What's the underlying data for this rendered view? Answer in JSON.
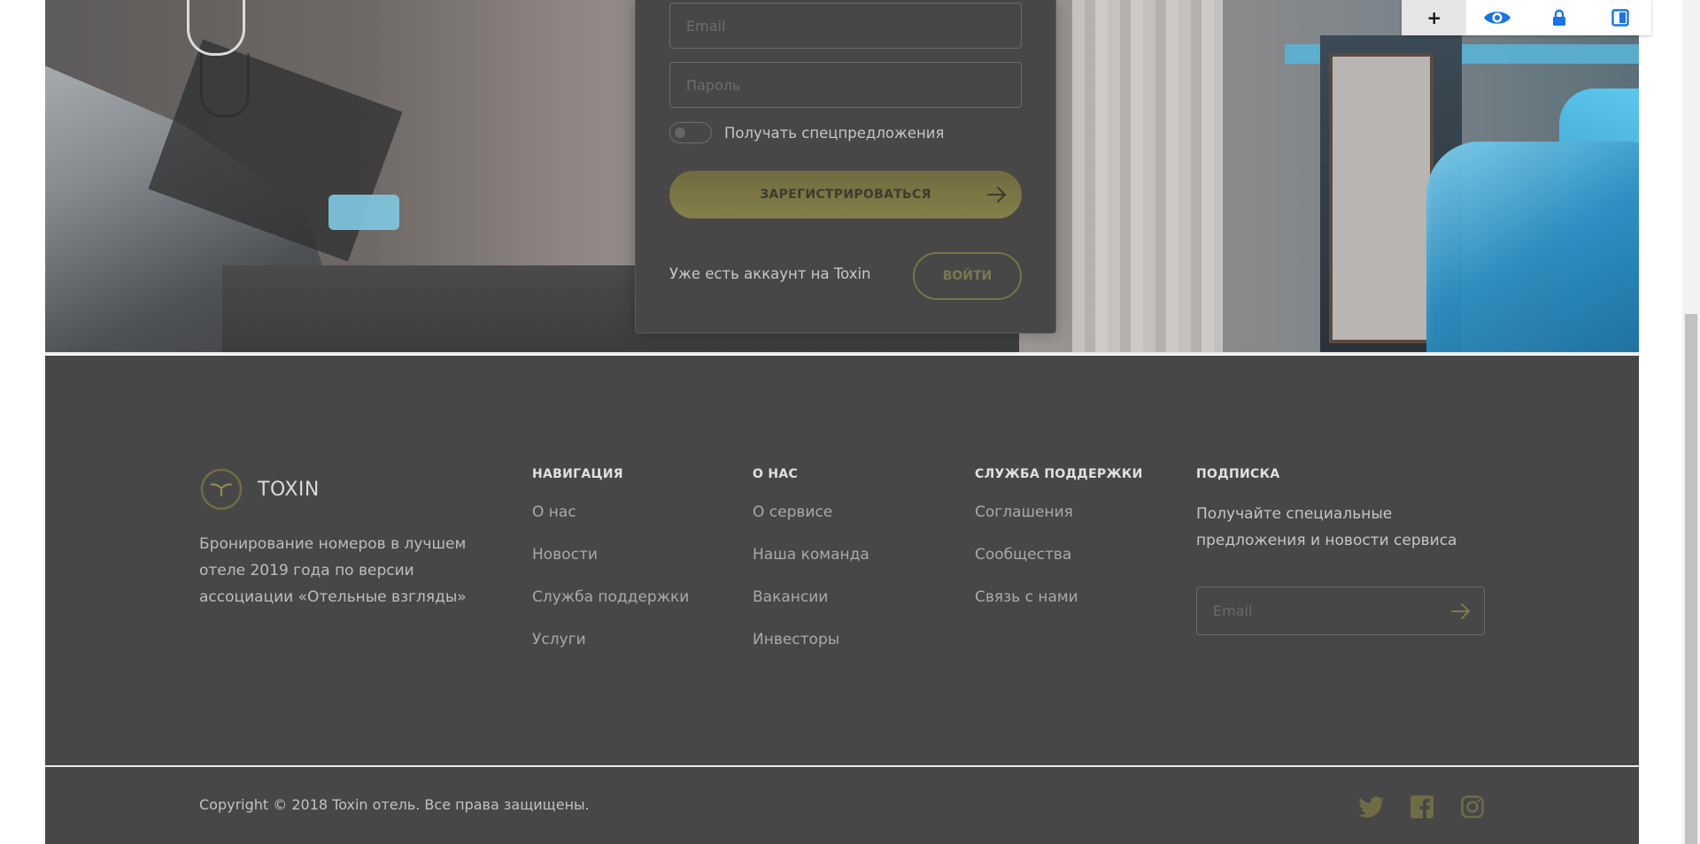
{
  "registration": {
    "email_placeholder": "Email",
    "password_placeholder": "Пароль",
    "special_offers_label": "Получать спецпредложения",
    "special_offers_on": false,
    "register_button": "ЗАРЕГИСТРИРОВАТЬСЯ",
    "have_account_text": "Уже есть аккаунт на Toxin",
    "login_button": "ВОЙТИ"
  },
  "extension_toolbar": {
    "icons": [
      "plus-icon",
      "eye-icon",
      "lock-icon",
      "sidebar-icon"
    ],
    "plus_label": "+"
  },
  "footer": {
    "brand": "TOXIN",
    "about": "Бронирование номеров в лучшем отеле 2019 года по версии ассоциации «Отельные взгляды»",
    "columns": [
      {
        "title": "НАВИГАЦИЯ",
        "links": [
          "О нас",
          "Новости",
          "Служба поддержки",
          "Услуги"
        ]
      },
      {
        "title": "О НАС",
        "links": [
          "О сервисе",
          "Наша команда",
          "Вакансии",
          "Инвесторы"
        ]
      },
      {
        "title": "СЛУЖБА ПОДДЕРЖКИ",
        "links": [
          "Соглашения",
          "Сообщества",
          "Связь с нами"
        ]
      }
    ],
    "subscribe": {
      "title": "ПОДПИСКА",
      "text": "Получайте специальные предложения и новости сервиса",
      "email_placeholder": "Email"
    },
    "copyright": "Copyright © 2018 Toxin отель. Все права защищены.",
    "socials": [
      "twitter-icon",
      "facebook-icon",
      "instagram-icon"
    ]
  },
  "colors": {
    "accent": "#7e7a48",
    "panel": "#474747",
    "toolbar_blue": "#1a73e8"
  }
}
